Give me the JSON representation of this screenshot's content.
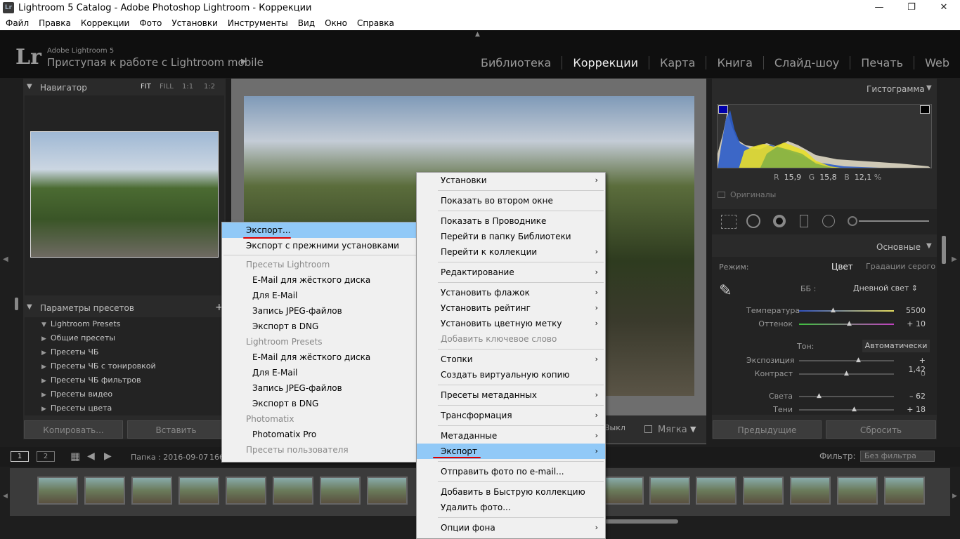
{
  "window": {
    "title": "Lightroom 5 Catalog - Adobe Photoshop Lightroom - Коррекции",
    "app_icon": "Lr"
  },
  "menubar": [
    "Файл",
    "Правка",
    "Коррекции",
    "Фото",
    "Установки",
    "Инструменты",
    "Вид",
    "Окно",
    "Справка"
  ],
  "header": {
    "logo": "Lr",
    "sub1": "Adobe Lightroom 5",
    "sub2": "Приступая к работе с Lightroom mobile",
    "play": "▶"
  },
  "modules": [
    {
      "label": "Библиотека",
      "active": false
    },
    {
      "label": "Коррекции",
      "active": true
    },
    {
      "label": "Карта",
      "active": false
    },
    {
      "label": "Книга",
      "active": false
    },
    {
      "label": "Слайд-шоу",
      "active": false
    },
    {
      "label": "Печать",
      "active": false
    },
    {
      "label": "Web",
      "active": false
    }
  ],
  "navigator": {
    "title": "Навигатор",
    "fit": "FIT",
    "fill": "FILL",
    "r11": "1:1",
    "r12": "1:2"
  },
  "presets": {
    "title": "Параметры пресетов",
    "add": "+",
    "items": [
      "Lightroom Presets",
      "Общие пресеты",
      "Пресеты ЧБ",
      "Пресеты ЧБ с тонировкой",
      "Пресеты ЧБ фильтров",
      "Пресеты видео",
      "Пресеты цвета"
    ]
  },
  "left_buttons": {
    "copy": "Копировать...",
    "paste": "Вставить"
  },
  "right": {
    "histogram_title": "Гистограмма",
    "rgb": {
      "r_label": "R",
      "r": "15,9",
      "g_label": "G",
      "g": "15,8",
      "b_label": "B",
      "b": "12,1",
      "pct": "%"
    },
    "originals": "Оригиналы",
    "basic_title": "Основные",
    "mode_label": "Режим:",
    "mode_color": "Цвет",
    "mode_gray": "Градации серого",
    "wb_label": "ББ :",
    "wb_value": "Дневной свет ⇕",
    "temp_label": "Температура",
    "temp_value": "5500",
    "tint_label": "Оттенок",
    "tint_value": "+ 10",
    "tone_label": "Тон:",
    "tone_auto": "Автоматически",
    "exp_label": "Экспозиция",
    "exp_value": "+ 1,42",
    "contrast_label": "Контраст",
    "contrast_value": "0",
    "high_label": "Света",
    "high_value": "– 62",
    "shadow_label": "Тени",
    "shadow_value": "+ 18",
    "prev_btn": "Предыдущие",
    "reset_btn": "Сбросить"
  },
  "toolbar": {
    "soft": "Мягка",
    "vykl": "Выкл"
  },
  "filmbar": {
    "one": "1",
    "two": "2",
    "folder": "Папка : 2016-09-07",
    "count": "166",
    "filter_label": "Фильтр:",
    "filter_value": "Без фильтра"
  },
  "left_menu": [
    {
      "label": "Экспорт...",
      "type": "item",
      "hl": true
    },
    {
      "label": "Экспорт с прежними установками",
      "type": "item"
    },
    {
      "type": "sep"
    },
    {
      "label": "Пресеты Lightroom",
      "type": "header"
    },
    {
      "label": "E-Mail для жёсткого диска",
      "type": "sub"
    },
    {
      "label": "Для E-Mail",
      "type": "sub"
    },
    {
      "label": "Запись JPEG-файлов",
      "type": "sub"
    },
    {
      "label": "Экспорт в DNG",
      "type": "sub"
    },
    {
      "label": "Lightroom Presets",
      "type": "header"
    },
    {
      "label": "E-Mail для жёсткого диска",
      "type": "sub"
    },
    {
      "label": "Для E-Mail",
      "type": "sub"
    },
    {
      "label": "Запись JPEG-файлов",
      "type": "sub"
    },
    {
      "label": "Экспорт в DNG",
      "type": "sub"
    },
    {
      "label": "Photomatix",
      "type": "header"
    },
    {
      "label": "Photomatix Pro",
      "type": "sub"
    },
    {
      "label": "Пресеты пользователя",
      "type": "header"
    }
  ],
  "right_menu": [
    {
      "label": "Установки",
      "arrow": true
    },
    {
      "sep": true
    },
    {
      "label": "Показать во втором окне"
    },
    {
      "sep": true
    },
    {
      "label": "Показать в Проводнике"
    },
    {
      "label": "Перейти в папку Библиотеки"
    },
    {
      "label": "Перейти к коллекции",
      "arrow": true
    },
    {
      "sep": true
    },
    {
      "label": "Редактирование",
      "arrow": true
    },
    {
      "sep": true
    },
    {
      "label": "Установить флажок",
      "arrow": true
    },
    {
      "label": "Установить рейтинг",
      "arrow": true
    },
    {
      "label": "Установить цветную метку",
      "arrow": true
    },
    {
      "label": "Добавить ключевое слово",
      "dis": true
    },
    {
      "sep": true
    },
    {
      "label": "Стопки",
      "arrow": true
    },
    {
      "label": "Создать виртуальную копию"
    },
    {
      "sep": true
    },
    {
      "label": "Пресеты метаданных",
      "arrow": true
    },
    {
      "sep": true
    },
    {
      "label": "Трансформация",
      "arrow": true
    },
    {
      "sep": true
    },
    {
      "label": "Метаданные",
      "arrow": true
    },
    {
      "label": "Экспорт",
      "arrow": true,
      "hl": true
    },
    {
      "sep": true
    },
    {
      "label": "Отправить фото по e-mail..."
    },
    {
      "sep": true
    },
    {
      "label": "Добавить в Быструю коллекцию"
    },
    {
      "label": "Удалить фото..."
    },
    {
      "sep": true
    },
    {
      "label": "Опции фона",
      "arrow": true
    }
  ],
  "colors": {
    "highlight": "#91c9f7",
    "annotation": "#d00000"
  }
}
